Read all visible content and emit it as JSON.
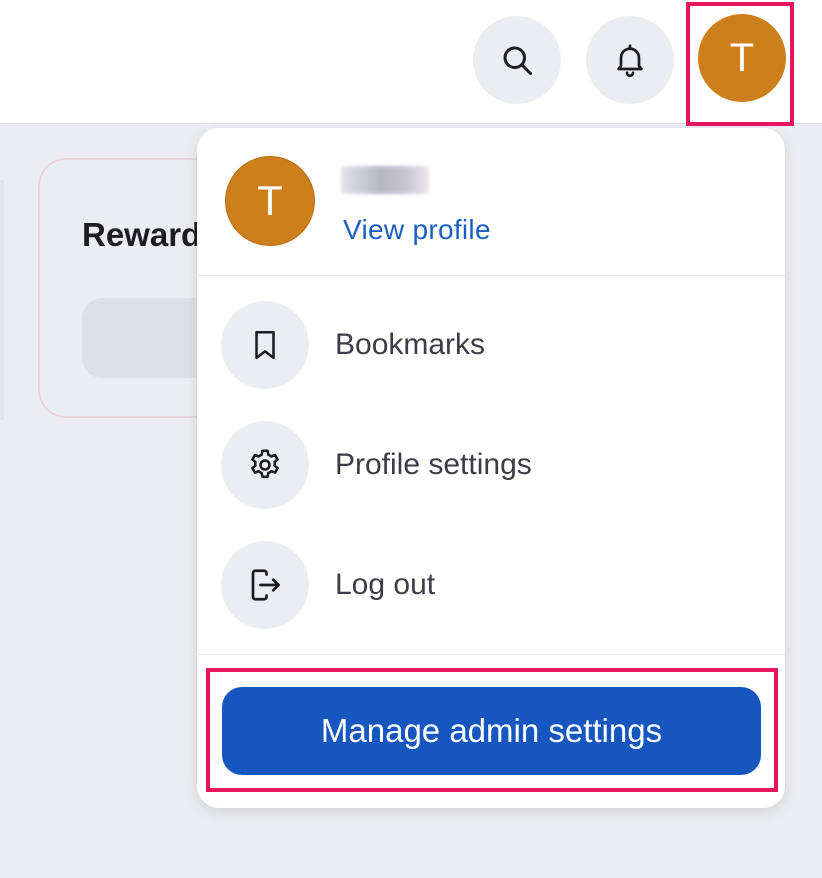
{
  "topbar": {
    "search_icon": "search-icon",
    "bell_icon": "bell-icon",
    "avatar_initial": "T"
  },
  "background_card": {
    "title": "Reward"
  },
  "dropdown": {
    "avatar_initial": "T",
    "view_profile_label": "View profile",
    "items": [
      {
        "icon": "bookmark-icon",
        "label": "Bookmarks"
      },
      {
        "icon": "gear-icon",
        "label": "Profile settings"
      },
      {
        "icon": "logout-icon",
        "label": "Log out"
      }
    ],
    "admin_button_label": "Manage admin settings"
  },
  "colors": {
    "avatar": "#cd7f1b",
    "accent": "#1656bf",
    "link": "#1b5fc4",
    "highlight": "#e8175d",
    "background": "#ecedf2"
  }
}
